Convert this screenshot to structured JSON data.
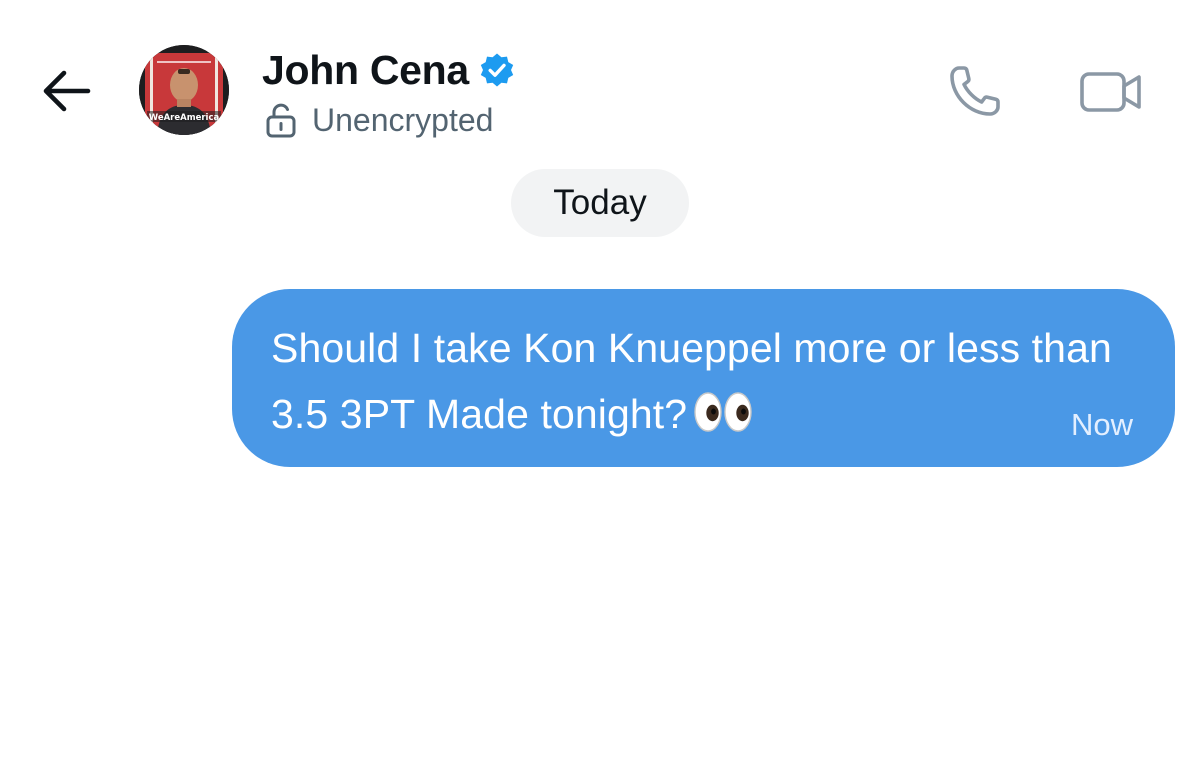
{
  "header": {
    "contact_name": "John Cena",
    "encryption_status": "Unencrypted",
    "avatar_caption": "WeAreAmerica",
    "icons": {
      "back": "arrow-left-icon",
      "verified": "verified-badge-icon",
      "lock": "unlocked-padlock-icon",
      "call": "phone-icon",
      "video": "video-camera-icon"
    }
  },
  "conversation": {
    "date_label": "Today",
    "messages": [
      {
        "sender": "me",
        "text": "Should I take Kon Knueppel more or less than 3.5 3PT Made tonight?",
        "emoji": "eyes",
        "time": "Now"
      }
    ]
  },
  "colors": {
    "accent": "#1d9bf0",
    "bubble": "#4a98e6",
    "secondary_text": "#536471",
    "pill": "#f2f3f4"
  }
}
